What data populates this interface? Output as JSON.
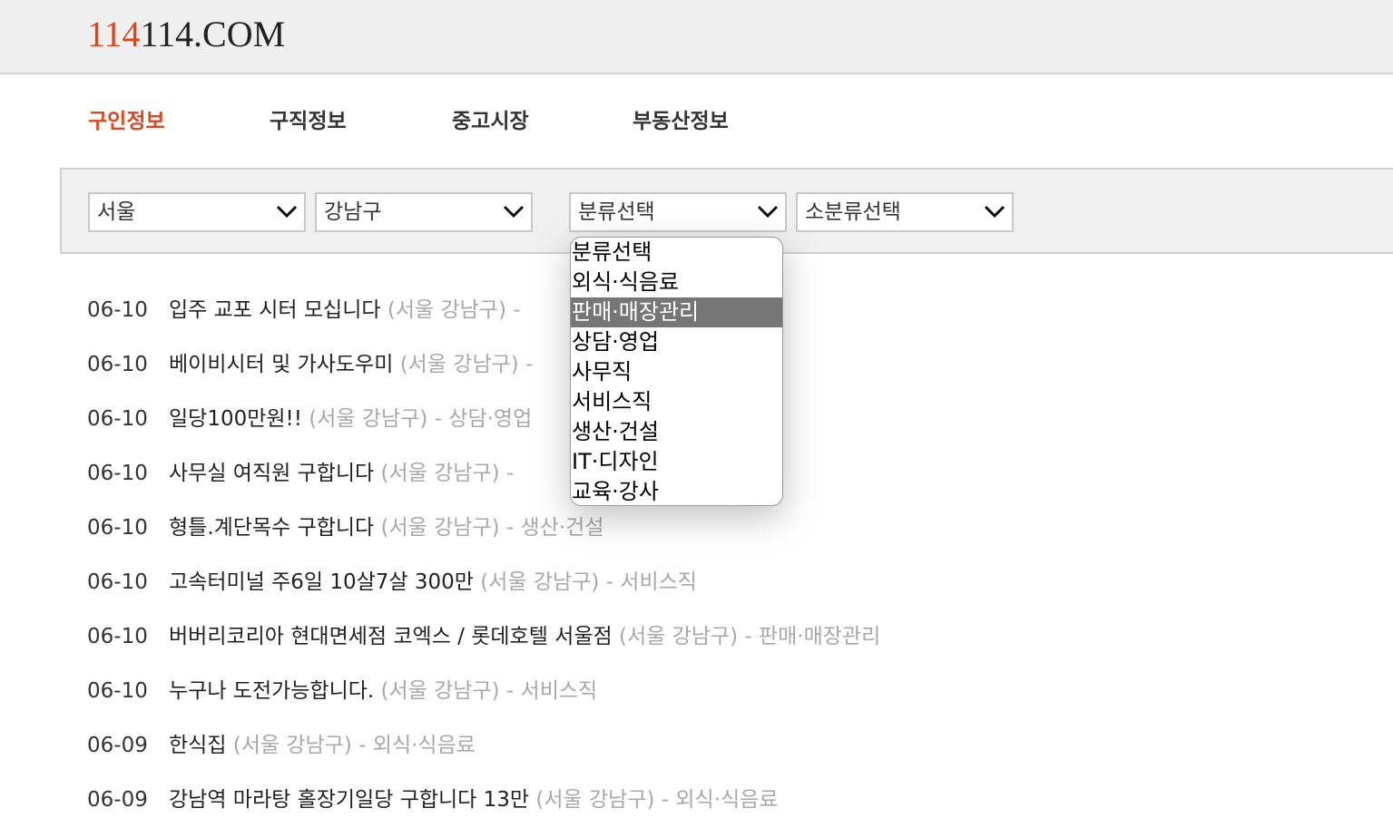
{
  "header": {
    "logo_accent": "114",
    "logo_rest": "114.COM"
  },
  "nav": {
    "items": [
      {
        "label": "구인정보",
        "active": true
      },
      {
        "label": "구직정보",
        "active": false
      },
      {
        "label": "중고시장",
        "active": false
      },
      {
        "label": "부동산정보",
        "active": false
      }
    ]
  },
  "filters": {
    "region": "서울",
    "district": "강남구",
    "category": "분류선택",
    "subcategory": "소분류선택"
  },
  "dropdown": {
    "options": [
      "분류선택",
      "외식·식음료",
      "판매·매장관리",
      "상담·영업",
      "사무직",
      "서비스직",
      "생산·건설",
      "IT·디자인",
      "교육·강사"
    ],
    "highlighted": "판매·매장관리"
  },
  "listings": [
    {
      "date": "06-10",
      "title": "입주 교포 시터 모십니다",
      "location": "(서울 강남구)",
      "sep": "-",
      "category": ""
    },
    {
      "date": "06-10",
      "title": "베이비시터 및 가사도우미",
      "location": "(서울 강남구)",
      "sep": "-",
      "category": ""
    },
    {
      "date": "06-10",
      "title": "일당100만원!!",
      "location": "(서울 강남구)",
      "sep": "-",
      "category": "상담·영업"
    },
    {
      "date": "06-10",
      "title": "사무실 여직원 구합니다",
      "location": "(서울 강남구)",
      "sep": "-",
      "category": ""
    },
    {
      "date": "06-10",
      "title": "형틀.계단목수 구합니다",
      "location": "(서울 강남구)",
      "sep": "-",
      "category": "생산·건설"
    },
    {
      "date": "06-10",
      "title": "고속터미널 주6일 10살7살 300만",
      "location": "(서울 강남구)",
      "sep": "-",
      "category": "서비스직"
    },
    {
      "date": "06-10",
      "title": "버버리코리아 현대면세점 코엑스 / 롯데호텔 서울점",
      "location": "(서울 강남구)",
      "sep": "-",
      "category": "판매·매장관리"
    },
    {
      "date": "06-10",
      "title": "누구나 도전가능합니다.",
      "location": "(서울 강남구)",
      "sep": "-",
      "category": "서비스직"
    },
    {
      "date": "06-09",
      "title": "한식집",
      "location": "(서울 강남구)",
      "sep": "-",
      "category": "외식·식음료"
    },
    {
      "date": "06-09",
      "title": "강남역 마라탕 홀장기일당 구합니다 13만",
      "location": "(서울 강남구)",
      "sep": "-",
      "category": "외식·식음료"
    }
  ]
}
